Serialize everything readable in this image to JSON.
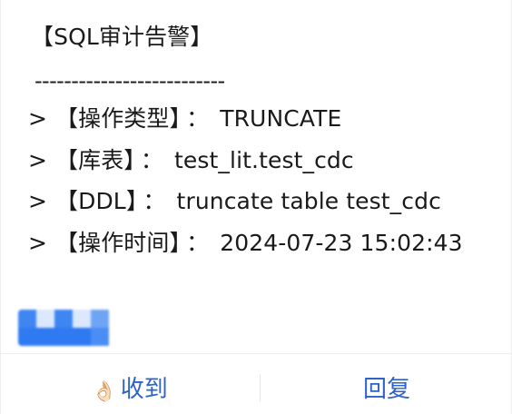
{
  "message": {
    "title": "【SQL审计告警】",
    "divider": "--------------------------",
    "rows": [
      {
        "arrow": ">",
        "label": "【操作类型】",
        "colon": "：",
        "value": "TRUNCATE"
      },
      {
        "arrow": ">",
        "label": "【库表】",
        "colon": "：",
        "value": "test_lit.test_cdc"
      },
      {
        "arrow": ">",
        "label": "【DDL】",
        "colon": "：",
        "value": "truncate table test_cdc"
      },
      {
        "arrow": ">",
        "label": "【操作时间】",
        "colon": "：",
        "value": "2024-07-23 15:02:43"
      }
    ]
  },
  "footer": {
    "ack_icon": "👌🏻",
    "ack_label": "收到",
    "reply_label": "回复"
  },
  "colors": {
    "link": "#2e63c9",
    "text": "#1a1a1a",
    "avatar_blue": "#3b82f6"
  }
}
